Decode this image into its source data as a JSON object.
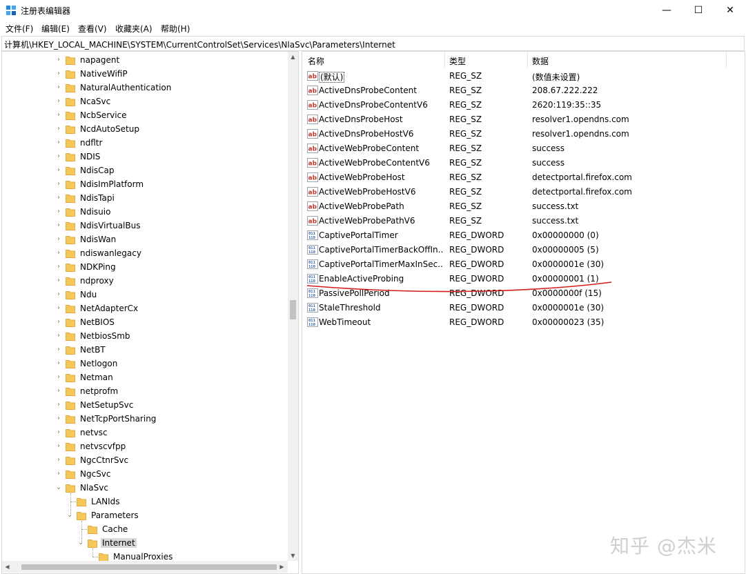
{
  "window": {
    "title": "注册表编辑器",
    "minimize": "—",
    "maximize": "☐",
    "close": "✕"
  },
  "menu": [
    "文件(F)",
    "编辑(E)",
    "查看(V)",
    "收藏夹(A)",
    "帮助(H)"
  ],
  "address": "计算机\\HKEY_LOCAL_MACHINE\\SYSTEM\\CurrentControlSet\\Services\\NlaSvc\\Parameters\\Internet",
  "colors": {
    "folder": "#f6c85a",
    "folder_edge": "#e0a93a",
    "sz_icon": "#c0392b",
    "dword_icon": "#2b5fa8",
    "annotation": "#d21c1c",
    "selected": "#d9d9d9"
  },
  "tree": [
    {
      "label": "napagent",
      "depth": 0,
      "expander": "collapsed"
    },
    {
      "label": "NativeWifiP",
      "depth": 0,
      "expander": "collapsed"
    },
    {
      "label": "NaturalAuthentication",
      "depth": 0,
      "expander": "collapsed"
    },
    {
      "label": "NcaSvc",
      "depth": 0,
      "expander": "collapsed"
    },
    {
      "label": "NcbService",
      "depth": 0,
      "expander": "collapsed"
    },
    {
      "label": "NcdAutoSetup",
      "depth": 0,
      "expander": "collapsed"
    },
    {
      "label": "ndfltr",
      "depth": 0,
      "expander": "collapsed"
    },
    {
      "label": "NDIS",
      "depth": 0,
      "expander": "collapsed"
    },
    {
      "label": "NdisCap",
      "depth": 0,
      "expander": "collapsed"
    },
    {
      "label": "NdisImPlatform",
      "depth": 0,
      "expander": "collapsed"
    },
    {
      "label": "NdisTapi",
      "depth": 0,
      "expander": "collapsed"
    },
    {
      "label": "Ndisuio",
      "depth": 0,
      "expander": "collapsed"
    },
    {
      "label": "NdisVirtualBus",
      "depth": 0,
      "expander": "collapsed"
    },
    {
      "label": "NdisWan",
      "depth": 0,
      "expander": "collapsed"
    },
    {
      "label": "ndiswanlegacy",
      "depth": 0,
      "expander": "collapsed"
    },
    {
      "label": "NDKPing",
      "depth": 0,
      "expander": "collapsed"
    },
    {
      "label": "ndproxy",
      "depth": 0,
      "expander": "collapsed"
    },
    {
      "label": "Ndu",
      "depth": 0,
      "expander": "collapsed"
    },
    {
      "label": "NetAdapterCx",
      "depth": 0,
      "expander": "collapsed"
    },
    {
      "label": "NetBIOS",
      "depth": 0,
      "expander": "collapsed"
    },
    {
      "label": "NetbiosSmb",
      "depth": 0,
      "expander": "collapsed"
    },
    {
      "label": "NetBT",
      "depth": 0,
      "expander": "collapsed"
    },
    {
      "label": "Netlogon",
      "depth": 0,
      "expander": "collapsed"
    },
    {
      "label": "Netman",
      "depth": 0,
      "expander": "collapsed"
    },
    {
      "label": "netprofm",
      "depth": 0,
      "expander": "collapsed"
    },
    {
      "label": "NetSetupSvc",
      "depth": 0,
      "expander": "collapsed"
    },
    {
      "label": "NetTcpPortSharing",
      "depth": 0,
      "expander": "collapsed"
    },
    {
      "label": "netvsc",
      "depth": 0,
      "expander": "collapsed"
    },
    {
      "label": "netvscvfpp",
      "depth": 0,
      "expander": "collapsed"
    },
    {
      "label": "NgcCtnrSvc",
      "depth": 0,
      "expander": "collapsed"
    },
    {
      "label": "NgcSvc",
      "depth": 0,
      "expander": "collapsed"
    },
    {
      "label": "NlaSvc",
      "depth": 0,
      "expander": "expanded"
    },
    {
      "label": "LANIds",
      "depth": 1,
      "expander": "none"
    },
    {
      "label": "Parameters",
      "depth": 1,
      "expander": "expanded"
    },
    {
      "label": "Cache",
      "depth": 2,
      "expander": "none"
    },
    {
      "label": "Internet",
      "depth": 2,
      "expander": "expanded",
      "selected": true
    },
    {
      "label": "ManualProxies",
      "depth": 3,
      "expander": "none"
    }
  ],
  "list": {
    "headers": {
      "name": "名称",
      "type": "类型",
      "data": "数据"
    },
    "rows": [
      {
        "name": "(默认)",
        "type": "REG_SZ",
        "data": "(数值未设置)",
        "kind": "sz",
        "default": true
      },
      {
        "name": "ActiveDnsProbeContent",
        "type": "REG_SZ",
        "data": "208.67.222.222",
        "kind": "sz"
      },
      {
        "name": "ActiveDnsProbeContentV6",
        "type": "REG_SZ",
        "data": "2620:119:35::35",
        "kind": "sz"
      },
      {
        "name": "ActiveDnsProbeHost",
        "type": "REG_SZ",
        "data": "resolver1.opendns.com",
        "kind": "sz"
      },
      {
        "name": "ActiveDnsProbeHostV6",
        "type": "REG_SZ",
        "data": "resolver1.opendns.com",
        "kind": "sz"
      },
      {
        "name": "ActiveWebProbeContent",
        "type": "REG_SZ",
        "data": "success",
        "kind": "sz"
      },
      {
        "name": "ActiveWebProbeContentV6",
        "type": "REG_SZ",
        "data": "success",
        "kind": "sz"
      },
      {
        "name": "ActiveWebProbeHost",
        "type": "REG_SZ",
        "data": "detectportal.firefox.com",
        "kind": "sz"
      },
      {
        "name": "ActiveWebProbeHostV6",
        "type": "REG_SZ",
        "data": "detectportal.firefox.com",
        "kind": "sz"
      },
      {
        "name": "ActiveWebProbePath",
        "type": "REG_SZ",
        "data": "success.txt",
        "kind": "sz"
      },
      {
        "name": "ActiveWebProbePathV6",
        "type": "REG_SZ",
        "data": "success.txt",
        "kind": "sz"
      },
      {
        "name": "CaptivePortalTimer",
        "type": "REG_DWORD",
        "data": "0x00000000 (0)",
        "kind": "dword"
      },
      {
        "name": "CaptivePortalTimerBackOffIn...",
        "type": "REG_DWORD",
        "data": "0x00000005 (5)",
        "kind": "dword"
      },
      {
        "name": "CaptivePortalTimerMaxInSec...",
        "type": "REG_DWORD",
        "data": "0x0000001e (30)",
        "kind": "dword"
      },
      {
        "name": "EnableActiveProbing",
        "type": "REG_DWORD",
        "data": "0x00000001 (1)",
        "kind": "dword"
      },
      {
        "name": "PassivePollPeriod",
        "type": "REG_DWORD",
        "data": "0x0000000f (15)",
        "kind": "dword"
      },
      {
        "name": "StaleThreshold",
        "type": "REG_DWORD",
        "data": "0x0000001e (30)",
        "kind": "dword"
      },
      {
        "name": "WebTimeout",
        "type": "REG_DWORD",
        "data": "0x00000023 (35)",
        "kind": "dword"
      }
    ]
  },
  "icons": {
    "sz": "ab",
    "dword": "011\n110"
  },
  "watermark": "知乎 @杰米"
}
